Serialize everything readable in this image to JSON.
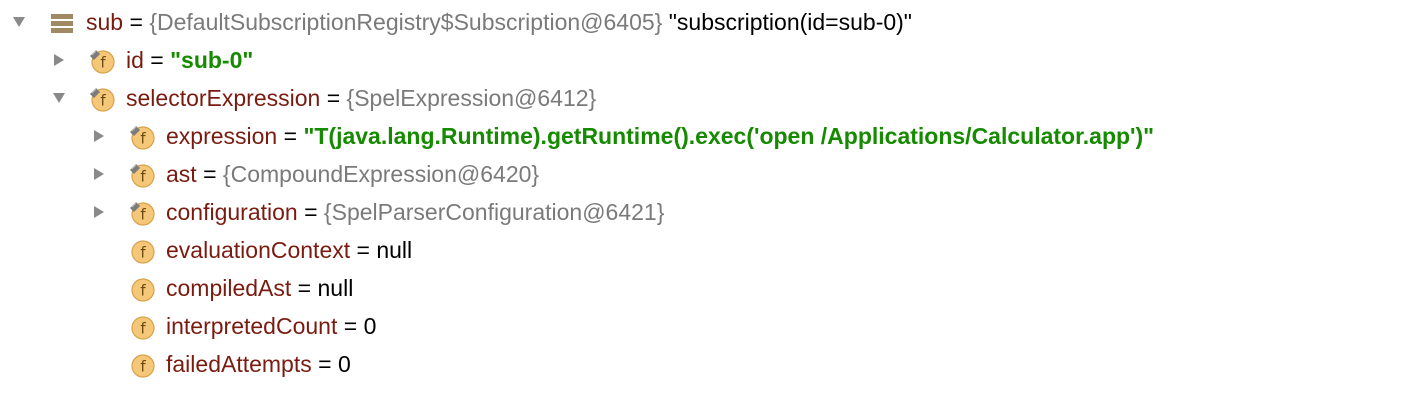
{
  "rows": [
    {
      "level": 0,
      "expander": "expanded",
      "icon": "stack-icon",
      "name": "sub",
      "eq": " = ",
      "ref": "{DefaultSubscriptionRegistry$Subscription@6405}",
      "value": "",
      "valueType": "",
      "label": " \"subscription(id=sub-0)\""
    },
    {
      "level": 1,
      "expander": "collapsed",
      "icon": "final-field-icon",
      "name": "id",
      "eq": " = ",
      "ref": "",
      "value": "\"sub-0\"",
      "valueType": "string",
      "label": ""
    },
    {
      "level": 1,
      "expander": "expanded",
      "icon": "final-field-icon",
      "name": "selectorExpression",
      "eq": " = ",
      "ref": "{SpelExpression@6412}",
      "value": "",
      "valueType": "",
      "label": ""
    },
    {
      "level": 2,
      "expander": "collapsed",
      "icon": "final-field-icon",
      "name": "expression",
      "eq": " = ",
      "ref": "",
      "value": "\"T(java.lang.Runtime).getRuntime().exec('open /Applications/Calculator.app')\"",
      "valueType": "string",
      "label": ""
    },
    {
      "level": 2,
      "expander": "collapsed",
      "icon": "final-field-icon",
      "name": "ast",
      "eq": " = ",
      "ref": "{CompoundExpression@6420}",
      "value": "",
      "valueType": "",
      "label": ""
    },
    {
      "level": 2,
      "expander": "collapsed",
      "icon": "final-field-icon",
      "name": "configuration",
      "eq": " = ",
      "ref": "{SpelParserConfiguration@6421}",
      "value": "",
      "valueType": "",
      "label": ""
    },
    {
      "level": 2,
      "expander": "none",
      "icon": "field-icon",
      "name": "evaluationContext",
      "eq": " = ",
      "ref": "",
      "value": "null",
      "valueType": "plain",
      "label": ""
    },
    {
      "level": 2,
      "expander": "none",
      "icon": "field-icon",
      "name": "compiledAst",
      "eq": " = ",
      "ref": "",
      "value": "null",
      "valueType": "plain",
      "label": ""
    },
    {
      "level": 2,
      "expander": "none",
      "icon": "field-icon",
      "name": "interpretedCount",
      "eq": " = ",
      "ref": "",
      "value": "0",
      "valueType": "plain",
      "label": ""
    },
    {
      "level": 2,
      "expander": "none",
      "icon": "field-icon",
      "name": "failedAttempts",
      "eq": " = ",
      "ref": "",
      "value": "0",
      "valueType": "plain",
      "label": ""
    }
  ],
  "colors": {
    "fieldName": "#7a1b10",
    "stringValue": "#168a00",
    "reference": "#7a7a7a",
    "iconFill": "#f5c778",
    "iconStroke": "#d7a24a",
    "iconLetter": "#6b4a12",
    "expander": "#8a8a8a",
    "stackIcon": "#a08a64"
  },
  "iconLetter": "f"
}
